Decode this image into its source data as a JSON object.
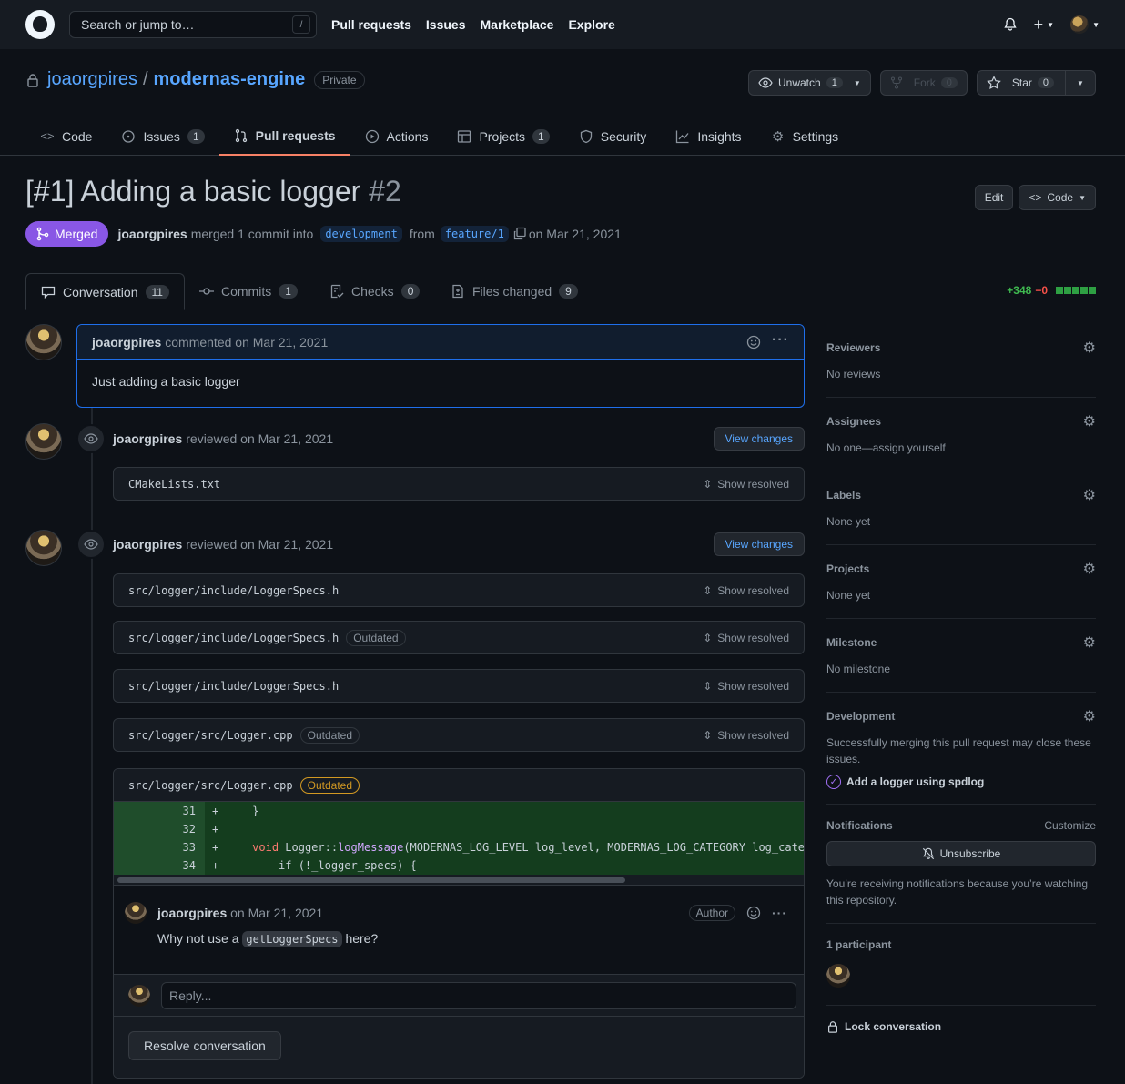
{
  "header": {
    "search_placeholder": "Search or jump to…",
    "search_shortcut": "/",
    "nav": [
      "Pull requests",
      "Issues",
      "Marketplace",
      "Explore"
    ]
  },
  "repo": {
    "owner": "joaorgpires",
    "separator": "/",
    "name": "modernas-engine",
    "visibility": "Private",
    "unwatch_label": "Unwatch",
    "unwatch_count": "1",
    "fork_label": "Fork",
    "fork_count": "0",
    "star_label": "Star",
    "star_count": "0",
    "tabs": [
      {
        "label": "Code",
        "icon": "code-icon",
        "count": ""
      },
      {
        "label": "Issues",
        "icon": "issue-icon",
        "count": "1"
      },
      {
        "label": "Pull requests",
        "icon": "pull-request-icon",
        "count": ""
      },
      {
        "label": "Actions",
        "icon": "play-icon",
        "count": ""
      },
      {
        "label": "Projects",
        "icon": "table-icon",
        "count": "1"
      },
      {
        "label": "Security",
        "icon": "shield-icon",
        "count": ""
      },
      {
        "label": "Insights",
        "icon": "graph-icon",
        "count": ""
      },
      {
        "label": "Settings",
        "icon": "gear-icon",
        "count": ""
      }
    ]
  },
  "pr": {
    "title": "[#1] Adding a basic logger",
    "number": "#2",
    "edit_label": "Edit",
    "code_label": "Code",
    "state": "Merged",
    "author": "joaorgpires",
    "merge_text": "merged 1 commit into",
    "base_branch": "development",
    "from_text": "from",
    "head_branch": "feature/1",
    "date_text": "on Mar 21, 2021",
    "tabs": [
      {
        "label": "Conversation",
        "count": "11",
        "icon": "comment-icon"
      },
      {
        "label": "Commits",
        "count": "1",
        "icon": "commit-icon"
      },
      {
        "label": "Checks",
        "count": "0",
        "icon": "checklist-icon"
      },
      {
        "label": "Files changed",
        "count": "9",
        "icon": "file-diff-icon"
      }
    ],
    "additions": "+348",
    "deletions": "−0"
  },
  "timeline": {
    "first_comment": {
      "author": "joaorgpires",
      "action": "commented on Mar 21, 2021",
      "body": "Just adding a basic logger"
    },
    "reviews": [
      {
        "author": "joaorgpires",
        "action": "reviewed on Mar 21, 2021",
        "view_changes": "View changes",
        "files": [
          {
            "path": "CMakeLists.txt",
            "outdated": ""
          }
        ]
      },
      {
        "author": "joaorgpires",
        "action": "reviewed on Mar 21, 2021",
        "view_changes": "View changes",
        "files": [
          {
            "path": "src/logger/include/LoggerSpecs.h",
            "outdated": ""
          },
          {
            "path": "src/logger/include/LoggerSpecs.h",
            "outdated": "Outdated"
          },
          {
            "path": "src/logger/include/LoggerSpecs.h",
            "outdated": ""
          },
          {
            "path": "src/logger/src/Logger.cpp",
            "outdated": "Outdated"
          }
        ]
      }
    ],
    "show_resolved": "Show resolved",
    "thread": {
      "path": "src/logger/src/Logger.cpp",
      "outdated": "Outdated",
      "lines": [
        {
          "num": "31",
          "sign": "+",
          "code": "    }"
        },
        {
          "num": "32",
          "sign": "+",
          "code": ""
        },
        {
          "num": "33",
          "sign": "+",
          "code": "    void Logger::logMessage(MODERNAS_LOG_LEVEL log_level, MODERNAS_LOG_CATEGORY log_categ"
        },
        {
          "num": "34",
          "sign": "+",
          "code": "        if (!_logger_specs) {"
        }
      ],
      "comment_author": "joaorgpires",
      "comment_date": "on Mar 21, 2021",
      "author_label": "Author",
      "comment_pre": "Why not use a",
      "comment_code": "getLoggerSpecs",
      "comment_post": "here?",
      "reply_placeholder": "Reply...",
      "resolve_label": "Resolve conversation"
    }
  },
  "sidebar": {
    "reviewers_title": "Reviewers",
    "reviewers_value": "No reviews",
    "assignees_title": "Assignees",
    "assignees_value": "No one—assign yourself",
    "labels_title": "Labels",
    "labels_value": "None yet",
    "projects_title": "Projects",
    "projects_value": "None yet",
    "milestone_title": "Milestone",
    "milestone_value": "No milestone",
    "development_title": "Development",
    "development_value": "Successfully merging this pull request may close these issues.",
    "development_issue": "Add a logger using spdlog",
    "notifications_title": "Notifications",
    "customize_label": "Customize",
    "unsubscribe_label": "Unsubscribe",
    "notifications_reason": "You’re receiving notifications because you’re watching this repository.",
    "participants_title": "1 participant",
    "lock_label": "Lock conversation"
  }
}
